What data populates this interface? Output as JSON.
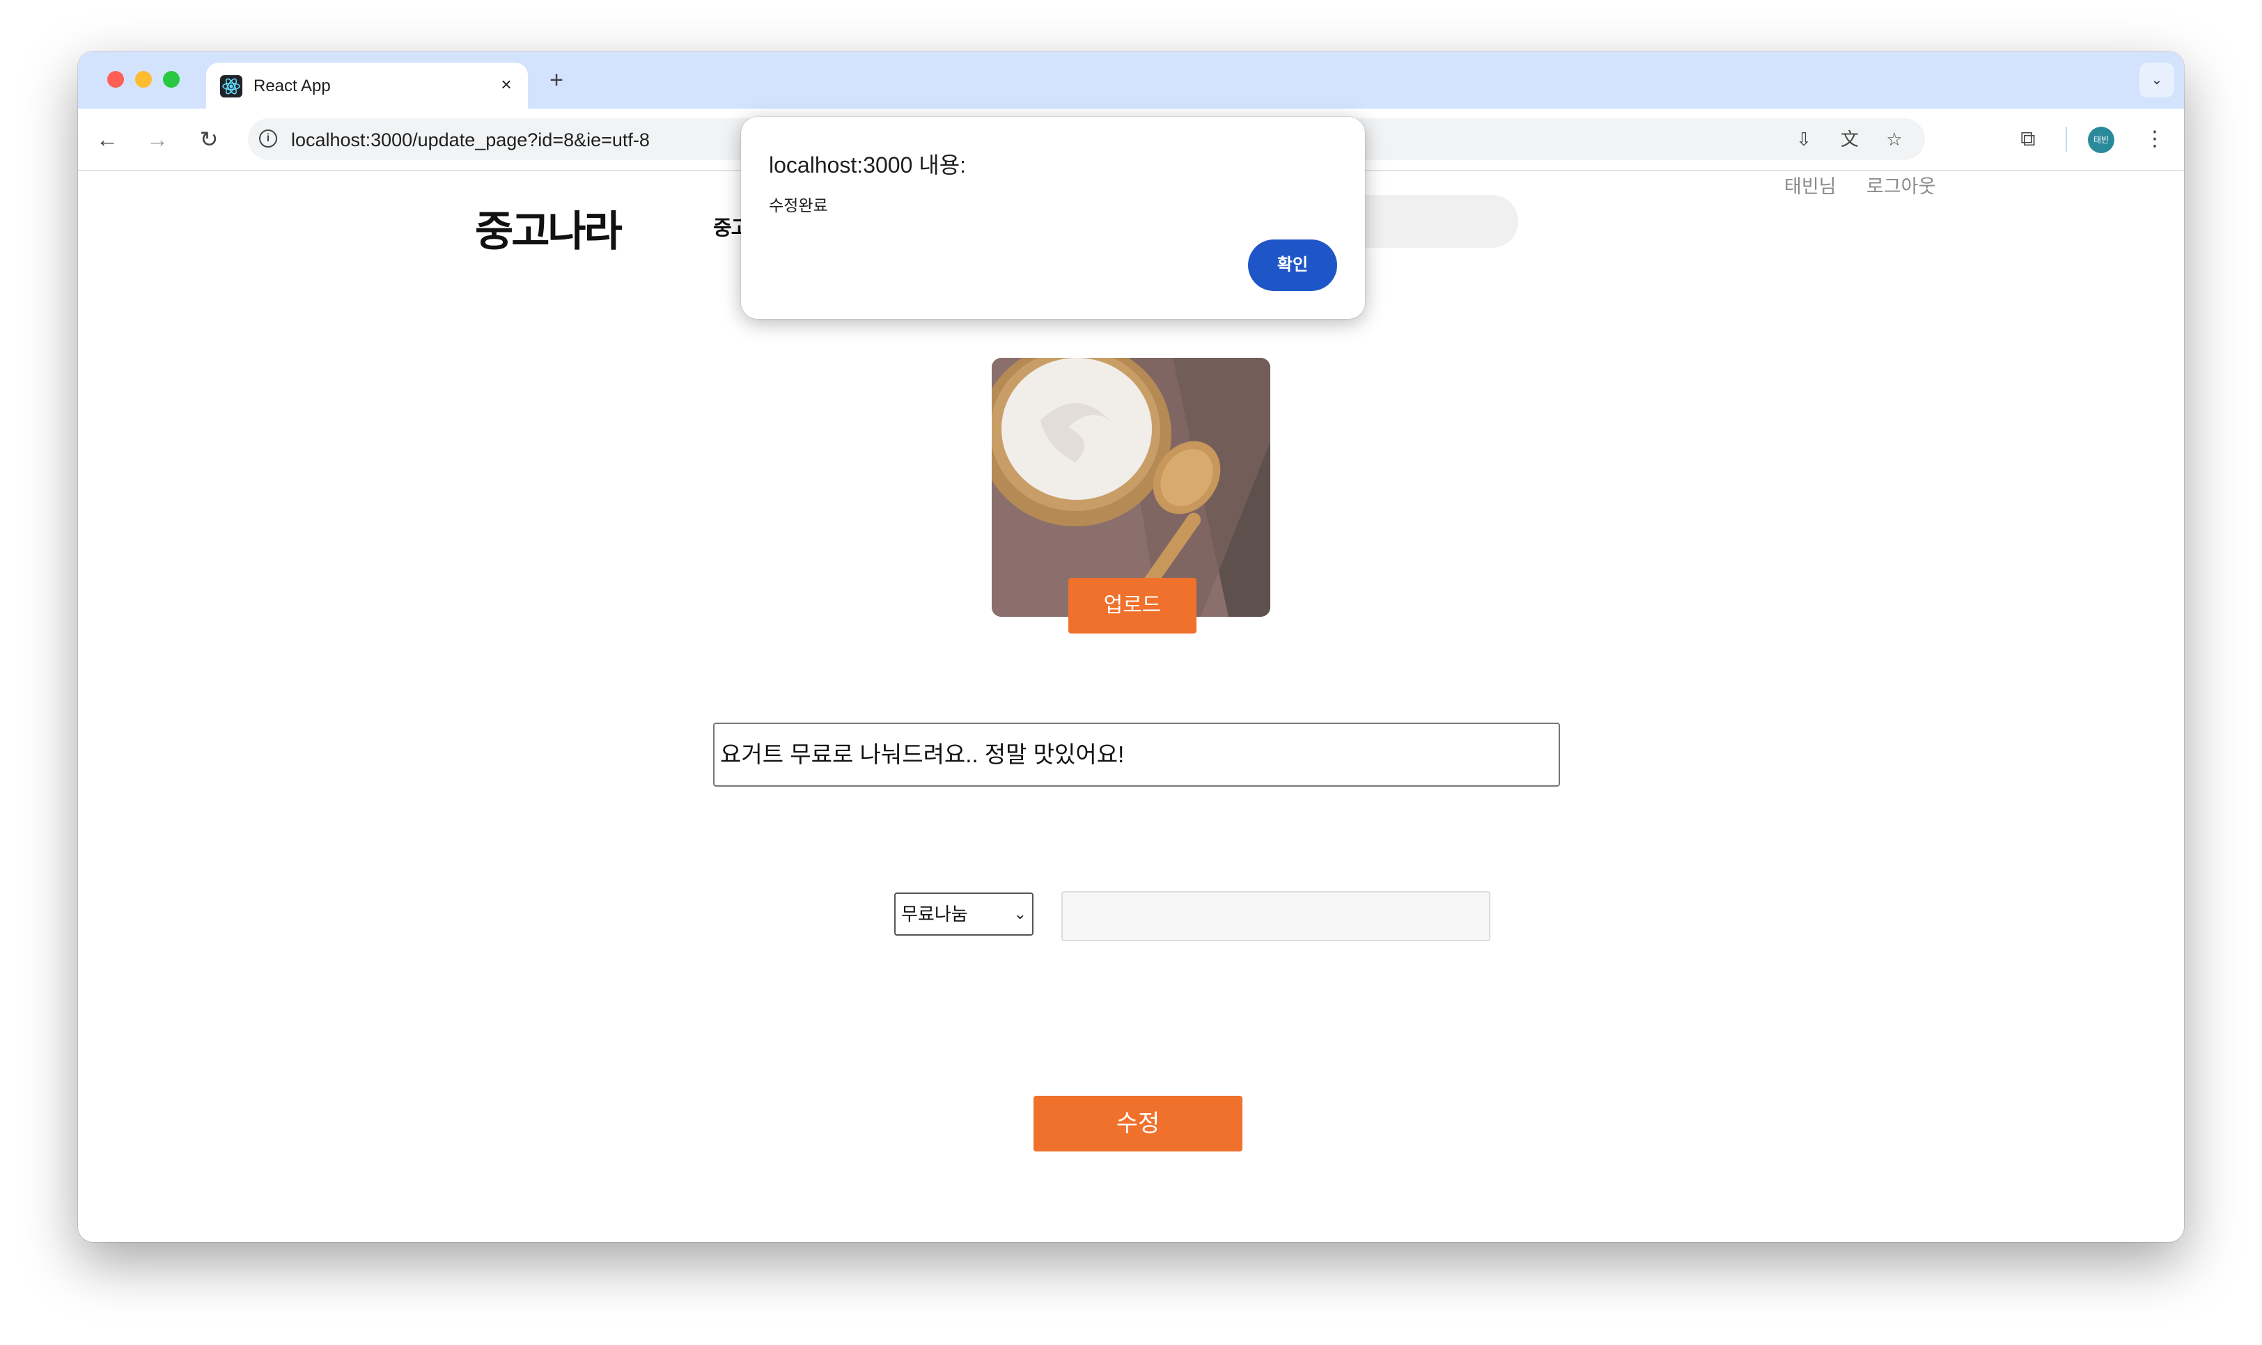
{
  "browser": {
    "tab_title": "React App",
    "tab_close": "×",
    "new_tab": "+",
    "tab_menu": "⌄",
    "url": "localhost:3000/update_page?id=8&ie=utf-8",
    "profile_initials": "태빈"
  },
  "header": {
    "logo": "중고나라",
    "nav_link": "중고거래",
    "user_name": "태빈님",
    "logout": "로그아웃"
  },
  "form": {
    "upload_label": "업로드",
    "title_value": "요거트 무료로 나눠드려요.. 정말 맛있어요!",
    "category_selected": "무료나눔",
    "price_value": "",
    "submit_label": "수정"
  },
  "dialog": {
    "title": "localhost:3000 내용:",
    "message": "수정완료",
    "ok_label": "확인"
  },
  "colors": {
    "accent": "#ef712c",
    "dialog_button": "#1f56c7",
    "tabbar": "#d3e3fd"
  }
}
